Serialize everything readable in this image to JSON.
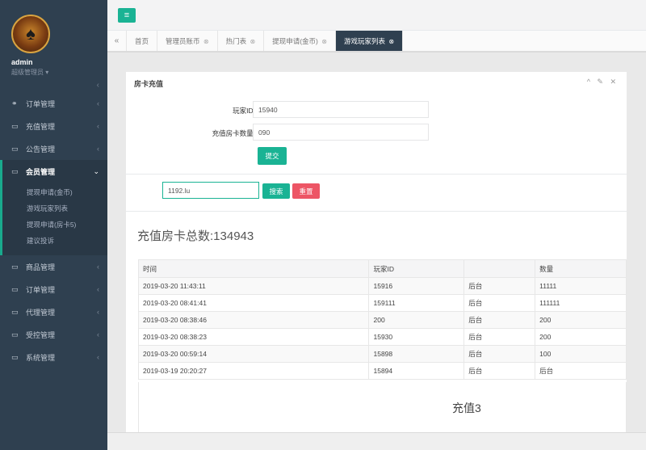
{
  "sidebar": {
    "admin_name": "admin",
    "admin_role": "超级管理员 ▾",
    "collapse": "‹",
    "menu_top": [
      {
        "label": "订单管理",
        "icon": "ℹ",
        "icon_name": "users-icon"
      },
      {
        "label": "充值管理",
        "icon": "▭",
        "icon_name": "desktop-icon"
      },
      {
        "label": "公告管理",
        "icon": "▭",
        "icon_name": "desktop-icon"
      }
    ],
    "active_menu": {
      "label": "会员管理",
      "icon": "▭",
      "arrow": "⌄"
    },
    "sub_items": [
      "提现申请(金币)",
      "游戏玩家列表",
      "提现申请(房卡5)",
      "建议投诉"
    ],
    "menu_bottom": [
      {
        "label": "商品管理",
        "icon": "▭"
      },
      {
        "label": "订单管理",
        "icon": "▭"
      },
      {
        "label": "代理管理",
        "icon": "▭"
      },
      {
        "label": "受控管理",
        "icon": "▭"
      },
      {
        "label": "系统管理",
        "icon": "▭"
      }
    ],
    "arrow": "‹"
  },
  "topbar": {
    "menu_icon": "≡"
  },
  "tabs": {
    "nav_back": "«",
    "items": [
      {
        "label": "首页",
        "close": ""
      },
      {
        "label": "管理员账币",
        "close": "⊗"
      },
      {
        "label": "热门表",
        "close": "⊗"
      },
      {
        "label": "提现申请(金币)",
        "close": "⊗"
      },
      {
        "label": "游戏玩家列表",
        "close": "⊗"
      }
    ]
  },
  "panel": {
    "title": "房卡充值",
    "tools": "^ ✎ ✕",
    "player_id_label": "玩家ID:",
    "player_id_value": "15940",
    "card_count_label": "充值房卡数量:",
    "card_count_value": "090",
    "submit_label": "提交",
    "search_value": "1192.lu",
    "search_label": "搜索",
    "reset_label": "重置",
    "total_label": "充值房卡总数:134943"
  },
  "table": {
    "headers": [
      "时间",
      "玩家ID",
      "",
      "数量"
    ],
    "rows": [
      [
        "2019-03-20 11:43:11",
        "15916",
        "后台",
        "11111"
      ],
      [
        "2019-03-20 08:41:41",
        "159111",
        "后台",
        "111111"
      ],
      [
        "2019-03-20 08:38:46",
        "200",
        "后台",
        "200"
      ],
      [
        "2019-03-20 08:38:23",
        "15930",
        "后台",
        "200"
      ],
      [
        "2019-03-20 00:59:14",
        "15898",
        "后台",
        "100"
      ],
      [
        "2019-03-19 20:20:27",
        "15894",
        "后台",
        "后台"
      ]
    ],
    "footer_text": "充值3"
  }
}
